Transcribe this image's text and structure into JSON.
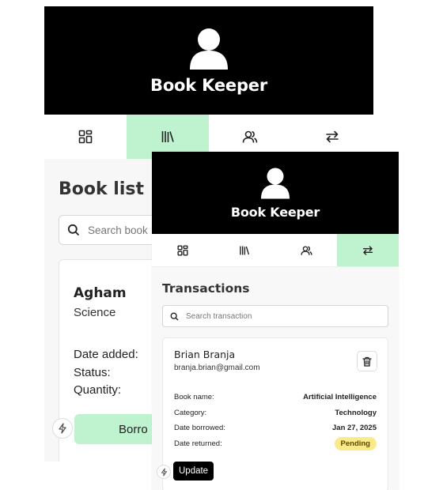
{
  "back_screen": {
    "app_title": "Book Keeper",
    "nav_icons": [
      "dashboard-icon",
      "books-icon",
      "users-icon",
      "transactions-icon"
    ],
    "active_tab": "books",
    "page_title": "Book list",
    "search_placeholder": "Search book",
    "book": {
      "title": "Agham",
      "category": "Science",
      "labels": [
        "Date added:",
        "Status:",
        "Quantity:"
      ]
    },
    "borrow_button": "Borro"
  },
  "front_screen": {
    "app_title": "Book Keeper",
    "nav_icons": [
      "dashboard-icon",
      "books-icon",
      "users-icon",
      "transactions-icon"
    ],
    "active_tab": "transactions",
    "page_title": "Transactions",
    "search_placeholder": "Search transaction",
    "transaction": {
      "name": "Brian Branja",
      "email": "branja.brian@gmail.com",
      "rows": [
        {
          "label": "Book name:",
          "value": "Artificial Intelligence"
        },
        {
          "label": "Category:",
          "value": "Technology"
        },
        {
          "label": "Date borrowed:",
          "value": "Jan 27, 2025"
        },
        {
          "label": "Date returned:",
          "value": "Pending"
        }
      ]
    },
    "update_button": "Update"
  },
  "colors": {
    "header_bg": "#000000",
    "active_tab": "#bff2cf",
    "pending_badge": "#fbe98a"
  }
}
